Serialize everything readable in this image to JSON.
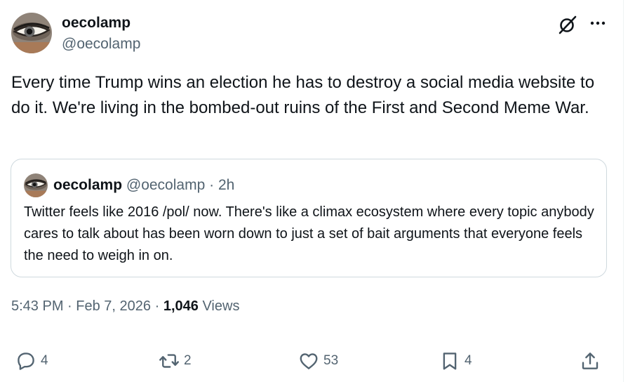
{
  "author": {
    "display_name": "oecolamp",
    "handle": "@oecolamp"
  },
  "tweet": {
    "text": "Every time Trump wins an election he has to destroy a social media website to do it. We're living in the bombed-out ruins of the First and Second Meme War."
  },
  "quoted_tweet": {
    "display_name": "oecolamp",
    "handle": "@oecolamp",
    "separator": "·",
    "age": "2h",
    "text": "Twitter feels like 2016 /pol/ now. There's like a climax ecosystem where every topic anybody cares to talk about has been worn down to just a set of bait arguments that everyone feels the need to weigh in on."
  },
  "meta": {
    "time": "5:43 PM",
    "separator": "·",
    "date": "Feb 7, 2026",
    "views_count": "1,046",
    "views_label": "Views"
  },
  "actions": {
    "reply_count": "4",
    "retweet_count": "2",
    "like_count": "53",
    "bookmark_count": "4"
  },
  "icons": {
    "header": [
      "grok-icon",
      "more-icon"
    ],
    "actions": [
      "reply-icon",
      "retweet-icon",
      "like-icon",
      "bookmark-icon",
      "share-icon"
    ]
  },
  "colors": {
    "text_primary": "#0f1419",
    "text_secondary": "#536471",
    "border": "#cfd9de"
  }
}
